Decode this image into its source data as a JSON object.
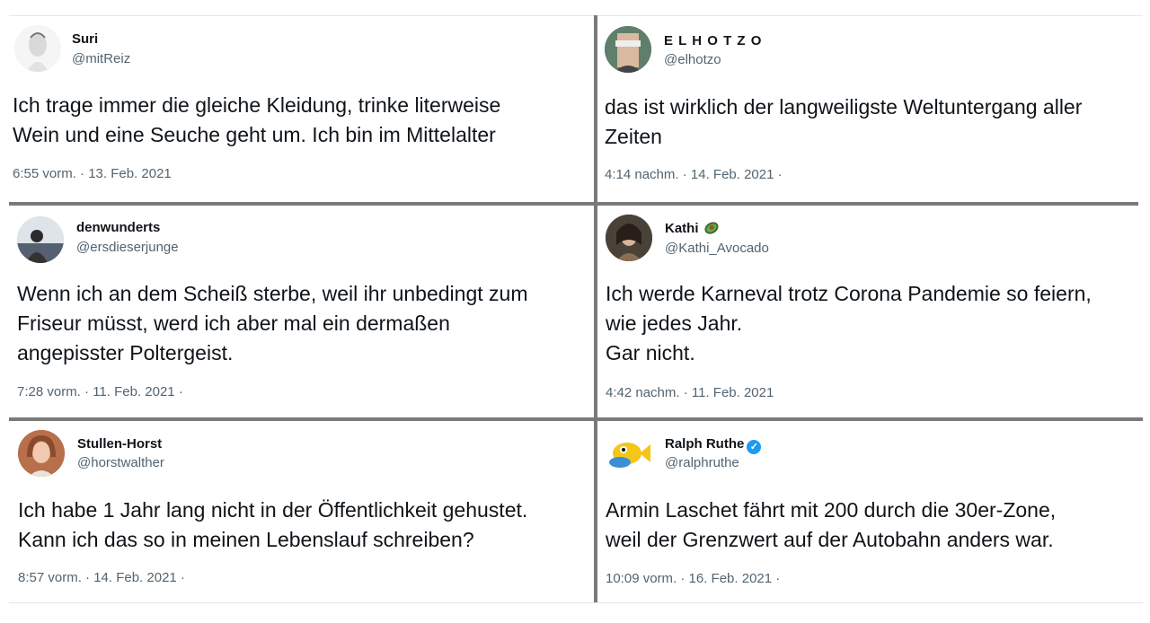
{
  "tweets": [
    {
      "name": "Suri",
      "handle": "@mitReiz",
      "text": "Ich trage immer die gleiche Kleidung, trinke literweise\nWein und eine Seuche geht um. Ich bin im Mittelalter",
      "meta": "6:55 vorm. · 13. Feb. 2021"
    },
    {
      "name": "E L H O T Z O",
      "handle": "@elhotzo",
      "text": "das ist wirklich der langweiligste Weltuntergang aller\nZeiten",
      "meta": "4:14 nachm. · 14. Feb. 2021 ·"
    },
    {
      "name": "denwunderts",
      "handle": "@ersdieserjunge",
      "text": "Wenn ich an dem Scheiß sterbe, weil ihr unbedingt zum\nFriseur müsst, werd ich aber mal ein dermaßen\nangepisster Poltergeist.",
      "meta": "7:28 vorm. · 11. Feb. 2021 ·"
    },
    {
      "name": "Kathi",
      "handle": "@Kathi_Avocado",
      "text": "Ich werde Karneval trotz Corona Pandemie so feiern,\nwie jedes Jahr.\nGar nicht.",
      "meta": "4:42 nachm. · 11. Feb. 2021"
    },
    {
      "name": "Stullen-Horst",
      "handle": "@horstwalther",
      "text": "Ich habe 1 Jahr lang nicht in der Öffentlichkeit gehustet.\nKann ich das so in meinen Lebenslauf schreiben?",
      "meta": "8:57 vorm. · 14. Feb. 2021 ·"
    },
    {
      "name": "Ralph Ruthe",
      "handle": "@ralphruthe",
      "text": "Armin Laschet fährt mit 200 durch die 30er-Zone,\n weil der Grenzwert auf der Autobahn anders war.",
      "meta": "10:09 vorm. · 16. Feb. 2021 ·"
    }
  ],
  "icons": {
    "verified": "verified-badge-icon",
    "avocado": "avocado-emoji-icon"
  },
  "colors": {
    "text": "#0f1419",
    "secondary": "#536471",
    "verified": "#1d9bf0",
    "divider": "#7a7a7a"
  }
}
